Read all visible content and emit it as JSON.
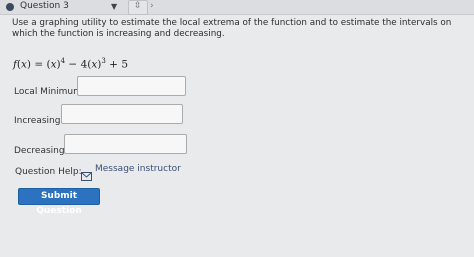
{
  "header": {
    "question_title": "Question 3"
  },
  "question": {
    "instructions": "Use a graphing utility to estimate the local extrema of the function and to estimate the intervals on which the function is increasing and decreasing."
  },
  "fields": {
    "local_minimum_label": "Local Minimum:",
    "increasing_label": "Increasing:",
    "decreasing_label": "Decreasing:",
    "local_minimum_value": "",
    "increasing_value": "",
    "decreasing_value": ""
  },
  "help": {
    "label": "Question Help:",
    "message_link": "Message instructor"
  },
  "actions": {
    "submit_label": "Submit Question"
  },
  "colors": {
    "accent": "#2b73c0",
    "link": "#3a4f73"
  }
}
